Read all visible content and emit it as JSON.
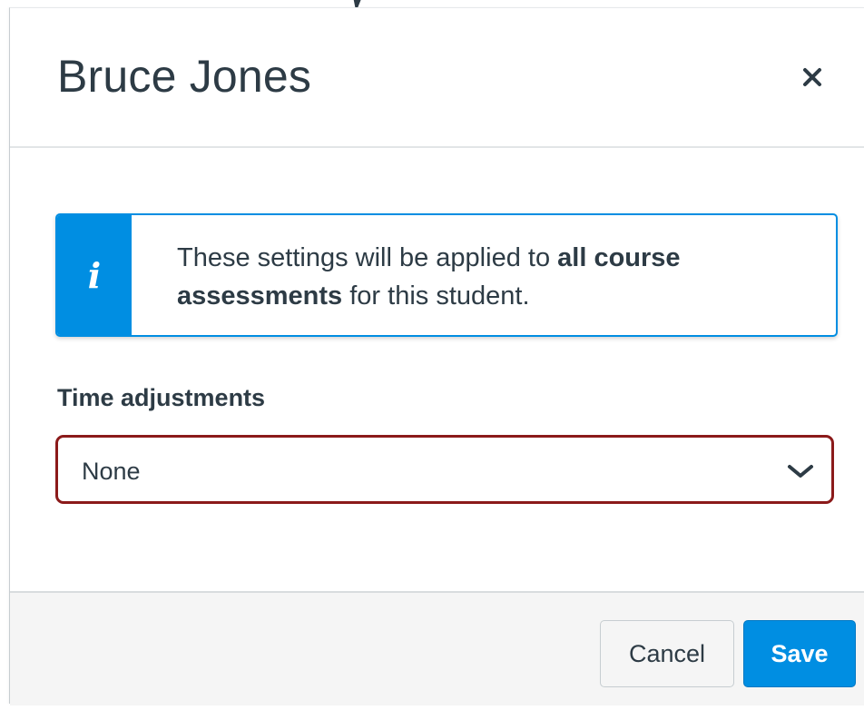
{
  "dialog": {
    "title": "Bruce Jones",
    "close_icon": "close-icon"
  },
  "info_alert": {
    "icon": "info-icon",
    "icon_glyph": "i",
    "text_before": "These settings will be applied to ",
    "text_bold": "all course assessments",
    "text_after": " for this student."
  },
  "time_adjustments": {
    "label": "Time adjustments",
    "selected_value": "None",
    "chevron_icon": "chevron-down-icon"
  },
  "footer": {
    "cancel_label": "Cancel",
    "save_label": "Save"
  },
  "colors": {
    "accent": "#008ee2",
    "text": "#2d3b45",
    "focus_border": "#8b1a1a",
    "footer_background": "#f5f5f5"
  }
}
